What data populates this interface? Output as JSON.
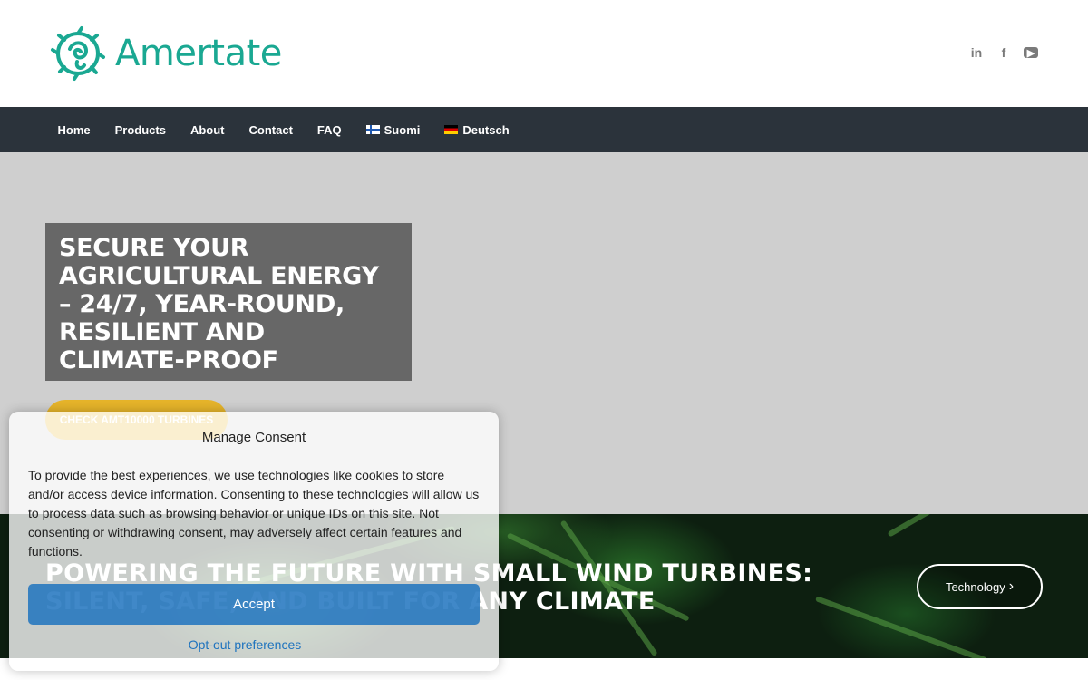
{
  "header": {
    "logo_text": "Amertate",
    "brand_color": "#1aa892",
    "socials": [
      {
        "name": "linkedin-icon",
        "glyph": "in"
      },
      {
        "name": "facebook-icon",
        "glyph": "f"
      },
      {
        "name": "youtube-icon",
        "glyph": "▶"
      }
    ]
  },
  "nav": {
    "items": [
      {
        "label": "Home"
      },
      {
        "label": "Products"
      },
      {
        "label": "About"
      },
      {
        "label": "Contact"
      },
      {
        "label": "FAQ"
      },
      {
        "label": "Suomi",
        "flag": "fi"
      },
      {
        "label": "Deutsch",
        "flag": "de"
      }
    ]
  },
  "hero": {
    "title": "SECURE YOUR AGRICULTURAL ENERGY – 24/7, YEAR-ROUND, RESILIENT AND CLIMATE-PROOF",
    "cta_label": "CHECK AMT10000 TURBINES",
    "cta_color": "#e6b42a"
  },
  "band": {
    "title_line1": "POWERING THE FUTURE WITH SMALL WIND TURBINES:",
    "title_line2": "SILENT, SAFE, AND BUILT FOR ANY CLIMATE",
    "button_label": "Technology",
    "button_chevron": "›"
  },
  "consent": {
    "title": "Manage Consent",
    "text": "To provide the best experiences, we use technologies like cookies to store and/or access device information. Consenting to these technologies will allow us to process data such as browsing behavior or unique IDs on this site. Not consenting or withdrawing consent, may adversely affect certain features and functions.",
    "accept_label": "Accept",
    "optout_label": "Opt-out preferences",
    "accent_color": "#1e73be"
  }
}
